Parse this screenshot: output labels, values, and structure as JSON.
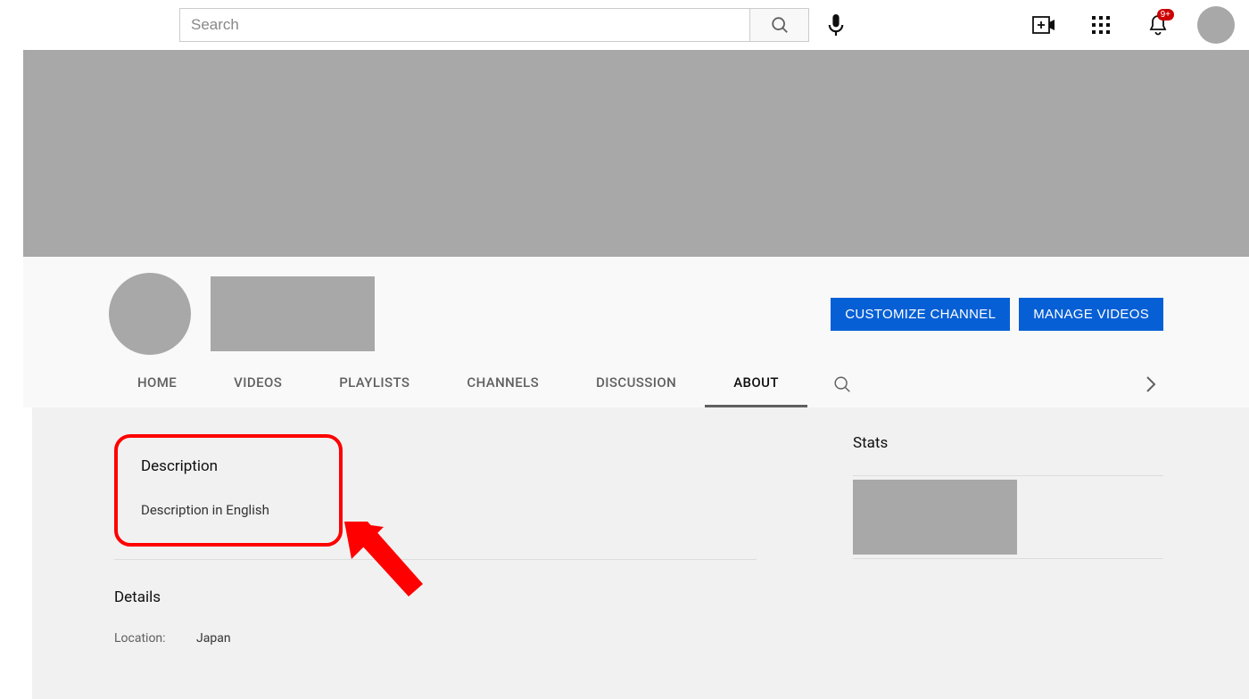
{
  "topbar": {
    "search_placeholder": "Search",
    "notification_badge": "9+"
  },
  "channel": {
    "actions": {
      "customize": "CUSTOMIZE CHANNEL",
      "manage": "MANAGE VIDEOS"
    },
    "tabs": [
      {
        "key": "home",
        "label": "HOME"
      },
      {
        "key": "videos",
        "label": "VIDEOS"
      },
      {
        "key": "playlists",
        "label": "PLAYLISTS"
      },
      {
        "key": "channels",
        "label": "CHANNELS"
      },
      {
        "key": "discussion",
        "label": "DISCUSSION"
      },
      {
        "key": "about",
        "label": "ABOUT"
      }
    ],
    "active_tab": "about"
  },
  "about": {
    "description_heading": "Description",
    "description_text": "Description in English",
    "details_heading": "Details",
    "details": {
      "location_label": "Location:",
      "location_value": "Japan"
    },
    "stats_heading": "Stats"
  },
  "colors": {
    "annotation": "#ff0000",
    "primary_button": "#065fd4"
  }
}
